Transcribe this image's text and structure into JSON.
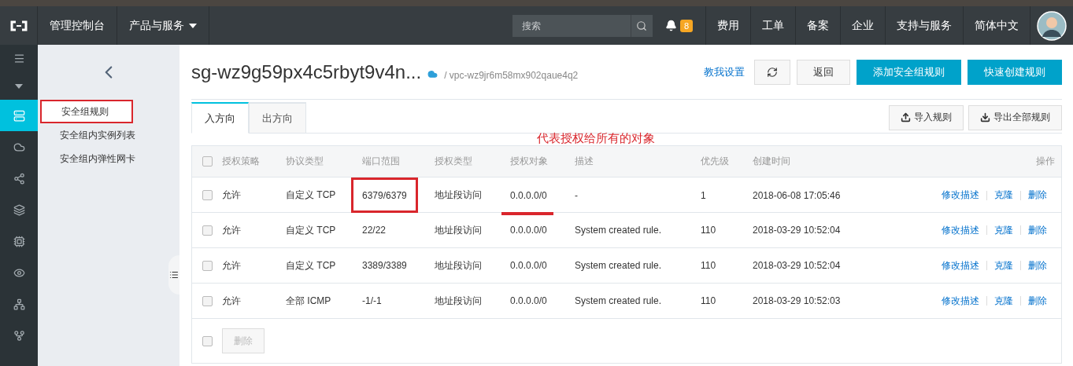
{
  "header": {
    "nav": [
      {
        "label": "管理控制台",
        "dropdown": false
      },
      {
        "label": "产品与服务",
        "dropdown": true
      }
    ],
    "search": {
      "placeholder": "搜索"
    },
    "notifications": {
      "count": "8"
    },
    "links": [
      "费用",
      "工单",
      "备案",
      "企业",
      "支持与服务",
      "简体中文"
    ]
  },
  "rail": {
    "items": [
      {
        "kind": "menu",
        "selected": false
      },
      {
        "kind": "caret",
        "selected": false
      },
      {
        "kind": "server",
        "selected": true
      },
      {
        "kind": "cloud",
        "selected": false
      },
      {
        "kind": "nodes",
        "selected": false
      },
      {
        "kind": "layers",
        "selected": false
      },
      {
        "kind": "chip",
        "selected": false
      },
      {
        "kind": "eye",
        "selected": false
      },
      {
        "kind": "hub",
        "selected": false
      },
      {
        "kind": "tree",
        "selected": false
      }
    ]
  },
  "sidebar": {
    "items": [
      {
        "label": "安全组规则",
        "selected": true,
        "marked": true
      },
      {
        "label": "安全组内实例列表",
        "selected": false,
        "marked": false
      },
      {
        "label": "安全组内弹性网卡",
        "selected": false,
        "marked": false
      }
    ]
  },
  "page": {
    "title": "sg-wz9g59px4c5rbyt9v4n...",
    "vpc": "/ vpc-wz9jr6m58mx902qaue4q2",
    "help_link": "教我设置",
    "buttons": [
      {
        "label": "返回",
        "kind": "default"
      },
      {
        "label": "添加安全组规则",
        "kind": "primary"
      },
      {
        "label": "快速创建规则",
        "kind": "primary"
      }
    ]
  },
  "tabs": [
    {
      "label": "入方向",
      "selected": true
    },
    {
      "label": "出方向",
      "selected": false
    }
  ],
  "tools": [
    {
      "label": "导入规则",
      "kind": "upload"
    },
    {
      "label": "导出全部规则",
      "kind": "download"
    }
  ],
  "annotation": {
    "note": "代表授权给所有的对象"
  },
  "table": {
    "all_checked": false,
    "columns": [
      "授权策略",
      "协议类型",
      "端口范围",
      "授权类型",
      "授权对象",
      "描述",
      "优先级",
      "创建时间",
      "操作"
    ],
    "rows": [
      {
        "checked": false,
        "policy": "允许",
        "protocol": "自定义 TCP",
        "port": "6379/6379",
        "auth_type": "地址段访问",
        "target": "0.0.0.0/0",
        "description": "-",
        "priority": "1",
        "created": "2018-06-08 17:05:46",
        "actions": [
          "修改描述",
          "克隆",
          "删除"
        ],
        "port_marked": true,
        "target_marked": true
      },
      {
        "checked": false,
        "policy": "允许",
        "protocol": "自定义 TCP",
        "port": "22/22",
        "auth_type": "地址段访问",
        "target": "0.0.0.0/0",
        "description": "System created rule.",
        "priority": "110",
        "created": "2018-03-29 10:52:04",
        "actions": [
          "修改描述",
          "克隆",
          "删除"
        ],
        "port_marked": false,
        "target_marked": false
      },
      {
        "checked": false,
        "policy": "允许",
        "protocol": "自定义 TCP",
        "port": "3389/3389",
        "auth_type": "地址段访问",
        "target": "0.0.0.0/0",
        "description": "System created rule.",
        "priority": "110",
        "created": "2018-03-29 10:52:04",
        "actions": [
          "修改描述",
          "克隆",
          "删除"
        ],
        "port_marked": false,
        "target_marked": false
      },
      {
        "checked": false,
        "policy": "允许",
        "protocol": "全部 ICMP",
        "port": "-1/-1",
        "auth_type": "地址段访问",
        "target": "0.0.0.0/0",
        "description": "System created rule.",
        "priority": "110",
        "created": "2018-03-29 10:52:03",
        "actions": [
          "修改描述",
          "克隆",
          "删除"
        ],
        "port_marked": false,
        "target_marked": false
      }
    ],
    "footer": {
      "checked": false,
      "button": "删除",
      "button_disabled": true
    }
  }
}
